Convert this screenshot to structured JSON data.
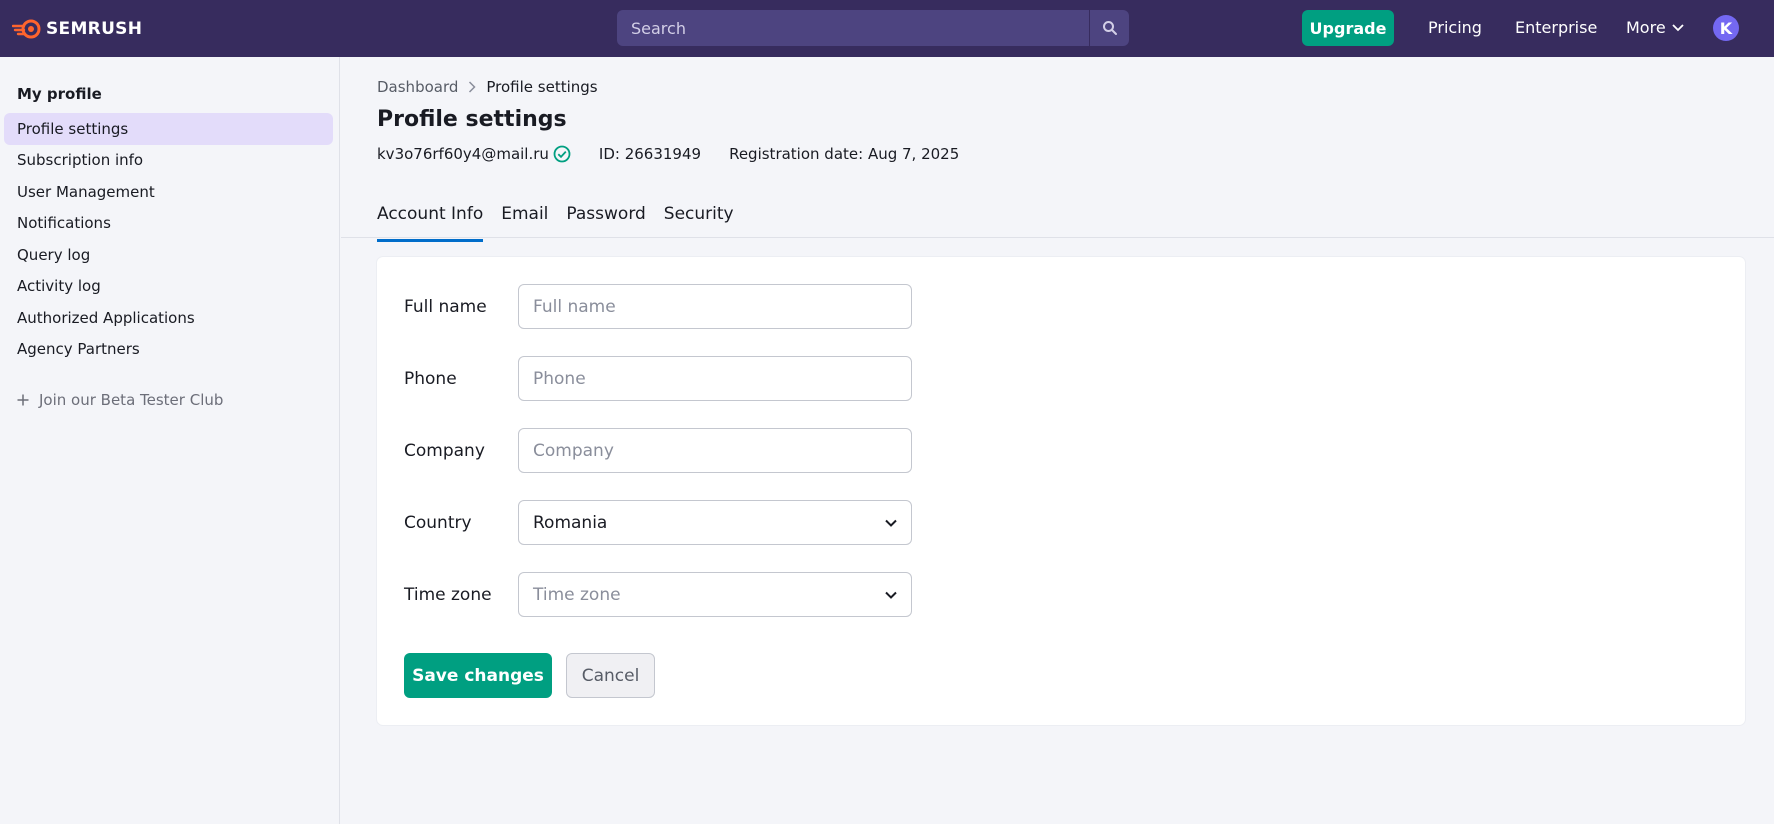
{
  "header": {
    "logo_text": "SEMRUSH",
    "search_placeholder": "Search",
    "upgrade_label": "Upgrade",
    "pricing_label": "Pricing",
    "enterprise_label": "Enterprise",
    "more_label": "More",
    "avatar_initial": "K",
    "brand_color": "#ff642d",
    "bar_color": "#372c5e"
  },
  "sidebar": {
    "title": "My profile",
    "items": [
      {
        "label": "Profile settings",
        "active": true
      },
      {
        "label": "Subscription info",
        "active": false
      },
      {
        "label": "User Management",
        "active": false
      },
      {
        "label": "Notifications",
        "active": false
      },
      {
        "label": "Query log",
        "active": false
      },
      {
        "label": "Activity log",
        "active": false
      },
      {
        "label": "Authorized Applications",
        "active": false
      },
      {
        "label": "Agency Partners",
        "active": false
      }
    ],
    "beta_label": "Join our Beta Tester Club"
  },
  "main": {
    "breadcrumb": {
      "root": "Dashboard",
      "current": "Profile settings"
    },
    "title": "Profile settings",
    "email": "kv3o76rf60y4@mail.ru",
    "user_id": "ID: 26631949",
    "registration": "Registration date: Aug 7, 2025",
    "tabs": [
      {
        "label": "Account Info",
        "active": true
      },
      {
        "label": "Email",
        "active": false
      },
      {
        "label": "Password",
        "active": false
      },
      {
        "label": "Security",
        "active": false
      }
    ],
    "form": {
      "full_name": {
        "label": "Full name",
        "placeholder": "Full name",
        "value": ""
      },
      "phone": {
        "label": "Phone",
        "placeholder": "Phone",
        "value": ""
      },
      "company": {
        "label": "Company",
        "placeholder": "Company",
        "value": ""
      },
      "country": {
        "label": "Country",
        "value": "Romania"
      },
      "time_zone": {
        "label": "Time zone",
        "placeholder": "Time zone",
        "value": ""
      }
    },
    "save_label": "Save changes",
    "cancel_label": "Cancel",
    "accent_color": "#009f81",
    "tab_active_color": "#006dca"
  }
}
